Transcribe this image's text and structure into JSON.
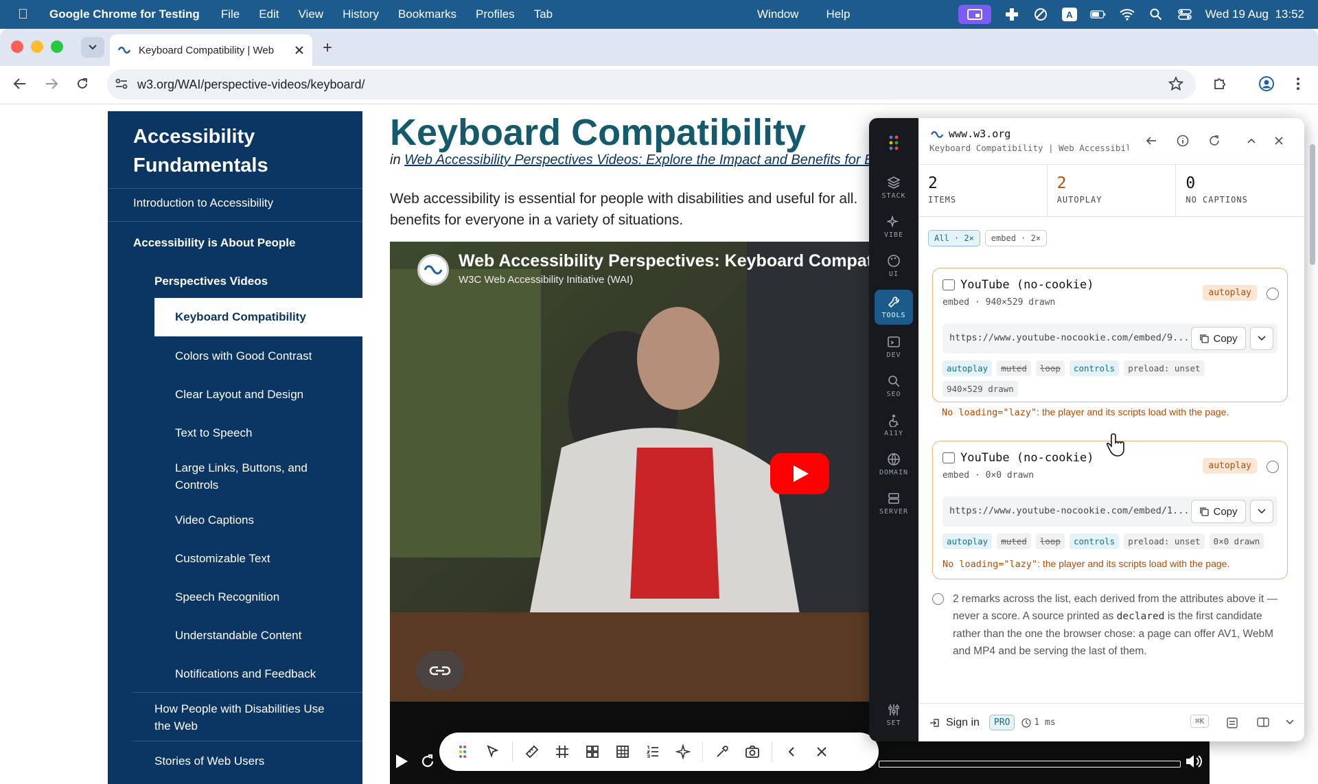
{
  "menubar": {
    "app_name": "Google Chrome for Testing",
    "items": [
      "File",
      "Edit",
      "View",
      "History",
      "Bookmarks",
      "Profiles",
      "Tab"
    ],
    "items_right": [
      "Window",
      "Help"
    ],
    "clock": "Wed 19 Aug  13:52"
  },
  "browser": {
    "tab_title": "Keyboard Compatibility | Web",
    "url": "w3.org/WAI/perspective-videos/keyboard/"
  },
  "sidenav": {
    "heading": "Accessibility Fundamentals",
    "items": [
      "Introduction to Accessibility",
      "Accessibility is About People",
      "Perspectives Videos",
      "Keyboard Compatibility",
      "Colors with Good Contrast",
      "Clear Layout and Design",
      "Text to Speech",
      "Large Links, Buttons, and Controls",
      "Video Captions",
      "Customizable Text",
      "Speech Recognition",
      "Understandable Content",
      "Notifications and Feedback",
      "How People with Disabilities Use the Web",
      "Stories of Web Users"
    ]
  },
  "page": {
    "title": "Keyboard Compatibility",
    "sub_prefix": "in",
    "sub_link": "Web Accessibility Perspectives Videos: Explore the Impact and Benefits for Everyone",
    "intro_line1": "Web accessibility is essential for people with disabilities and useful for all.",
    "intro_line2": "benefits for everyone in a variety of situations."
  },
  "video": {
    "title": "Web Accessibility Perspectives: Keyboard Compatibility",
    "channel": "W3C Web Accessibility Initiative (WAI)"
  },
  "extension": {
    "host": "www.w3.org",
    "subtitle": "Keyboard Compatibility | Web Accessibility Perspectives Videos",
    "rail": [
      "STACK",
      "VIBE",
      "UI",
      "TOOLS",
      "DEV",
      "SEO",
      "A11Y",
      "DOMAIN",
      "SERVER",
      "SET"
    ],
    "stats": [
      {
        "value": "2",
        "label": "ITEMS"
      },
      {
        "value": "2",
        "label": "AUTOPLAY"
      },
      {
        "value": "0",
        "label": "NO CAPTIONS"
      }
    ],
    "filters": [
      "All · 2×",
      "embed · 2×"
    ],
    "cards": [
      {
        "title": "YouTube (no-cookie)",
        "subtitle": "embed · 940×529 drawn",
        "badge": "autoplay",
        "url": "https://www.youtube-nocookie.com/embed/9...",
        "copy": "Copy",
        "tags": [
          "autoplay",
          "muted",
          "loop",
          "controls",
          "preload: unset"
        ],
        "tags2": [
          "940×529 drawn"
        ],
        "warning_code": "No loading=\"lazy\"",
        "warning_text": ": the player and its scripts load with the page."
      },
      {
        "title": "YouTube (no-cookie)",
        "subtitle": "embed · 0×0 drawn",
        "badge": "autoplay",
        "url": "https://www.youtube-nocookie.com/embed/1...",
        "copy": "Copy",
        "tags": [
          "autoplay",
          "muted",
          "loop",
          "controls",
          "preload: unset",
          "0×0 drawn"
        ],
        "warning_code": "No loading=\"lazy\"",
        "warning_text": ": the player and its scripts load with the page."
      }
    ],
    "remarks_1": "2 remarks across the list, each derived from the attributes above it — never a score. A source printed as ",
    "remarks_code": "declared",
    "remarks_2": " is the first candidate rather than the one the browser chose: a page can offer AV1, WebM and MP4 and be serving the last of them.",
    "footer": {
      "sign_in": "Sign in",
      "pro": "PRO",
      "timing": "1 ms",
      "shortcut": "⌘K"
    }
  }
}
